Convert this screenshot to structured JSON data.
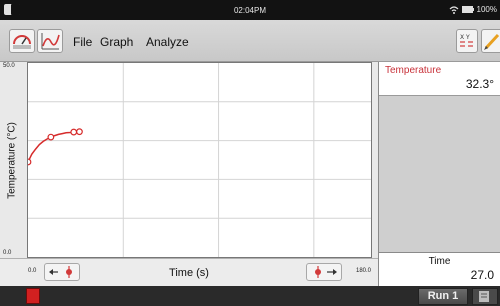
{
  "status_bar": {
    "clock": "02:04PM",
    "battery": "100%",
    "icons": [
      "home-icon",
      "wifi-icon",
      "battery-icon"
    ]
  },
  "toolbar": {
    "menus": [
      "File",
      "Graph",
      "Analyze"
    ],
    "icons": [
      "sensor-meter-icon",
      "graph-view-icon",
      "table-view-icon",
      "pencil-icon"
    ]
  },
  "graph": {
    "y_axis_label": "Temperature (°C)",
    "x_axis_label": "Time (s)",
    "y_max_tick": "50.0",
    "y_min_tick": "0.0",
    "x_min_tick": "0.0",
    "x_max_tick": "180.0",
    "line_color": "#d62b2b"
  },
  "chart_data": {
    "type": "line",
    "xlabel": "Time (s)",
    "ylabel": "Temperature (°C)",
    "xlim": [
      0,
      180
    ],
    "ylim": [
      0,
      50
    ],
    "grid": true,
    "series": [
      {
        "x": [
          0,
          2,
          4,
          6,
          8,
          10,
          12,
          14,
          16,
          18,
          20,
          22,
          24,
          27
        ],
        "y": [
          24.5,
          26.5,
          27.8,
          29.0,
          29.8,
          30.4,
          30.9,
          31.3,
          31.6,
          31.8,
          32.0,
          32.1,
          32.2,
          32.3
        ],
        "markers_at_index": [
          0,
          6,
          12,
          13
        ]
      }
    ]
  },
  "meters": {
    "temperature": {
      "name": "Temperature",
      "value": "32.3°",
      "color": "#c8323a"
    },
    "time": {
      "name": "Time",
      "value": "27.0"
    }
  },
  "bottom_bar": {
    "run_label": "Run 1"
  }
}
